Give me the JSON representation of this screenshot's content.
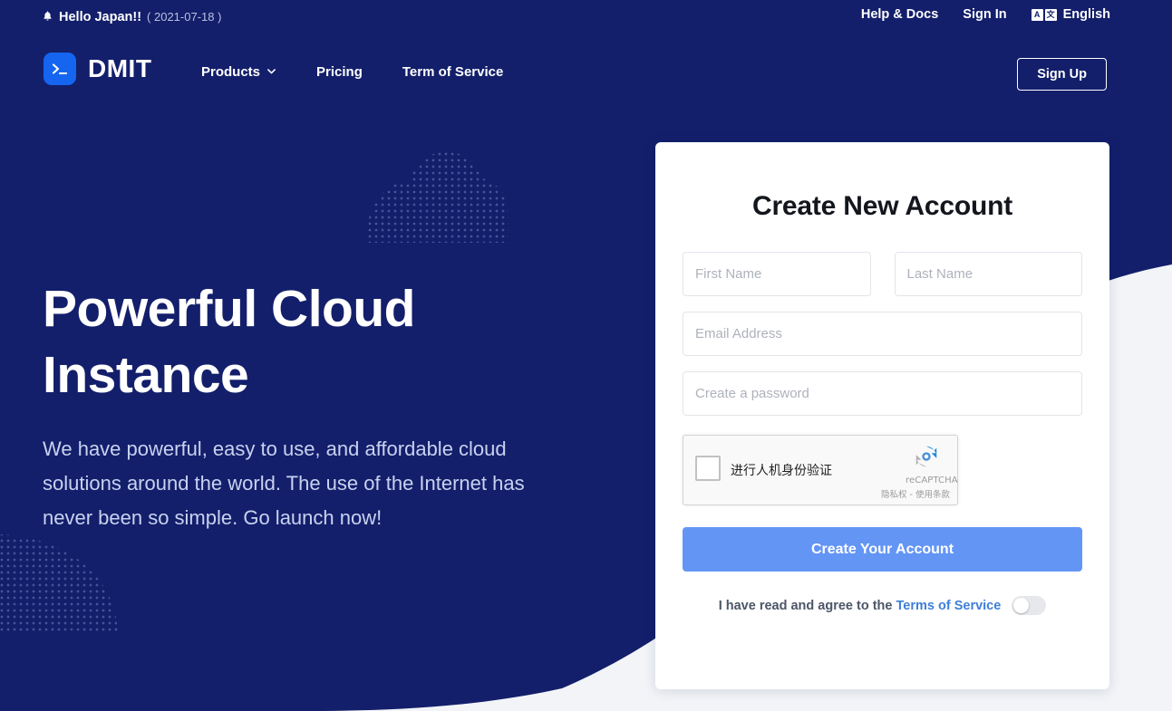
{
  "colors": {
    "navy": "#131f6b",
    "page_bg": "#f2f4f8",
    "logo_blue": "#1565f0",
    "button_blue": "#6395f5",
    "link_blue": "#3f7fd8"
  },
  "topbar": {
    "bell_icon": "bell-icon",
    "announcement": "Hello Japan!!",
    "announcement_date": "( 2021-07-18 )",
    "links": [
      {
        "label": "Help & Docs"
      },
      {
        "label": "Sign In"
      }
    ],
    "language": {
      "icon": "translate-icon",
      "glyph_a": "A",
      "glyph_cjk": "文",
      "label": "English"
    }
  },
  "nav": {
    "logo_icon": "terminal-prompt-icon",
    "brand": "DMIT",
    "links": [
      {
        "label": "Products",
        "has_dropdown": true,
        "chevron": "chevron-down-icon"
      },
      {
        "label": "Pricing",
        "has_dropdown": false
      },
      {
        "label": "Term of Service",
        "has_dropdown": false
      }
    ],
    "signup_label": "Sign Up"
  },
  "hero": {
    "title_line1": "Powerful Cloud",
    "title_line2": "Instance",
    "subtitle": "We have powerful, easy to use, and affordable cloud solutions around the world. The use of the Internet has never been so simple. Go launch now!",
    "cloud_decoration": "dotted-cloud-icon",
    "corner_decoration": "dotted-quarter-circle"
  },
  "signup_form": {
    "title": "Create New Account",
    "fields": [
      {
        "name": "first-name",
        "placeholder": "First Name",
        "value": ""
      },
      {
        "name": "last-name",
        "placeholder": "Last Name",
        "value": ""
      },
      {
        "name": "email",
        "placeholder": "Email Address",
        "value": ""
      },
      {
        "name": "password",
        "placeholder": "Create a password",
        "value": ""
      }
    ],
    "recaptcha": {
      "label": "进行人机身份验证",
      "brand": "reCAPTCHA",
      "legal": "隐私权 - 使用条款",
      "checked": false
    },
    "submit_label": "Create Your Account",
    "agree_text": "I have read and agree to the",
    "agree_link": "Terms of Service",
    "agree_toggle_on": false
  }
}
